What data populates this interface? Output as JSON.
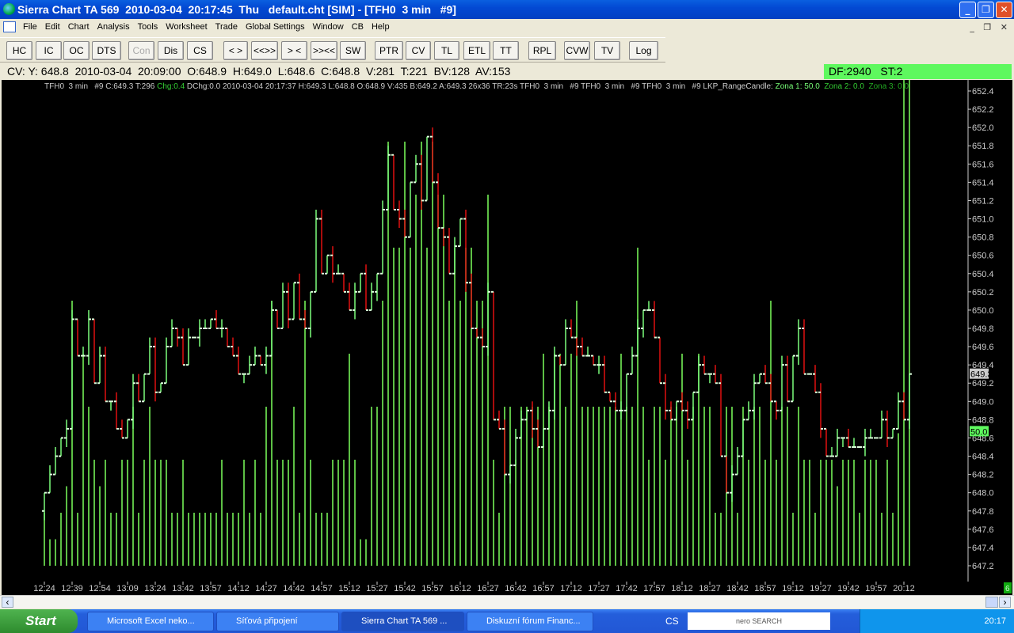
{
  "window": {
    "title": "Sierra Chart TA 569  2010-03-04  20:17:45  Thu   default.cht [SIM] - [TFH0  3 min   #9]",
    "minimize": "_",
    "restore": "❐",
    "close": "✕"
  },
  "menu": [
    "File",
    "Edit",
    "Chart",
    "Analysis",
    "Tools",
    "Worksheet",
    "Trade",
    "Global Settings",
    "Window",
    "CB",
    "Help"
  ],
  "mdi_controls": "_ ❐ ✕",
  "toolbar": [
    "HC",
    "IC",
    "OC",
    "DTS",
    "Con",
    "Dis",
    "CS",
    "< >",
    "<<>>",
    "> <",
    ">><<",
    "SW",
    "PTR",
    "CV",
    "TL",
    "ETL",
    "TT",
    "RPL",
    "CVW",
    "TV",
    "Log"
  ],
  "infobar": {
    "text": "CV: Y: 648.8  2010-03-04  20:09:00  O:648.9  H:649.0  L:648.6  C:648.8  V:281  T:221  BV:128  AV:153",
    "status": "DF:2940   ST:2"
  },
  "chart_header": {
    "a": "TFH0  3 min   #9 C:649.3 T:296 ",
    "chg": "Chg:0.4",
    "b": " DChg:0.0 2010-03-04 20:17:37 H:649.3 L:648.8 O:648.9 V:435 B:649.2 A:649.3 26x36 TR:23s TFH0  3 min   #9 TFH0  3 min   #9 TFH0  3 min   #9 LKP_RangeCandle: ",
    "z1": "Zona 1: 50.0",
    "z2": "Zona 2: 0.0",
    "z3": "Zona 3: 0.0"
  },
  "colors": {
    "up": "#7cff7c",
    "down": "#e01010",
    "volume": "#7cff5c",
    "axis": "#cccccc"
  },
  "chart_data": {
    "type": "bar",
    "ylim": [
      647.2,
      652.4
    ],
    "yticks": [
      "647.2",
      "647.4",
      "647.6",
      "647.8",
      "648.0",
      "648.2",
      "648.4",
      "648.6",
      "648.8",
      "649.0",
      "649.2",
      "649.4",
      "649.6",
      "649.8",
      "650.0",
      "650.2",
      "650.4",
      "650.6",
      "650.8",
      "651.0",
      "651.2",
      "651.4",
      "651.6",
      "651.8",
      "652.0",
      "652.2",
      "652.4"
    ],
    "xticks": [
      "12:24",
      "12:39",
      "12:54",
      "13:09",
      "13:24",
      "13:42",
      "13:57",
      "14:12",
      "14:27",
      "14:42",
      "14:57",
      "15:12",
      "15:27",
      "15:42",
      "15:57",
      "16:12",
      "16:27",
      "16:42",
      "16:57",
      "17:12",
      "17:27",
      "17:42",
      "17:57",
      "18:12",
      "18:27",
      "18:42",
      "18:57",
      "19:12",
      "19:27",
      "19:42",
      "19:57",
      "20:12"
    ],
    "first_open": 647.8,
    "close": [
      648.0,
      648.2,
      648.4,
      648.6,
      648.7,
      649.9,
      649.5,
      649.5,
      649.9,
      649.2,
      649.5,
      649.0,
      649.0,
      648.7,
      648.6,
      648.8,
      649.2,
      649.0,
      649.3,
      649.6,
      649.1,
      649.2,
      649.6,
      649.8,
      649.7,
      649.4,
      649.7,
      649.7,
      649.8,
      649.8,
      649.9,
      649.8,
      649.8,
      649.6,
      649.5,
      649.3,
      649.3,
      649.4,
      649.5,
      649.4,
      649.5,
      650.0,
      649.8,
      650.2,
      649.9,
      650.3,
      649.9,
      649.8,
      650.2,
      651.0,
      650.4,
      650.6,
      650.4,
      650.4,
      650.2,
      650.0,
      650.2,
      650.4,
      650.0,
      650.2,
      650.4,
      651.1,
      651.7,
      651.1,
      651.0,
      650.8,
      651.4,
      651.6,
      651.2,
      651.9,
      651.4,
      650.9,
      650.8,
      650.4,
      650.7,
      651.0,
      650.3,
      649.8,
      649.7,
      649.6,
      650.2,
      648.8,
      648.7,
      648.2,
      648.3,
      648.6,
      648.8,
      648.9,
      648.7,
      648.5,
      648.7,
      648.9,
      649.5,
      649.4,
      649.8,
      649.7,
      649.6,
      649.5,
      649.5,
      649.4,
      649.4,
      649.1,
      649.0,
      648.9,
      648.9,
      649.3,
      649.5,
      649.8,
      650.0,
      650.0,
      649.7,
      649.2,
      648.9,
      648.8,
      649.0,
      648.9,
      648.8,
      649.1,
      649.4,
      649.3,
      649.3,
      649.2,
      648.4,
      648.0,
      648.2,
      648.4,
      648.8,
      648.9,
      649.2,
      649.3,
      649.2,
      649.0,
      648.9,
      649.4,
      649.0,
      649.5,
      649.8,
      649.3,
      649.3,
      649.1,
      648.7,
      648.4,
      648.4,
      648.6,
      648.6,
      648.5,
      648.5,
      648.5,
      648.6,
      648.6,
      648.6,
      648.8,
      648.6,
      648.7,
      649.0,
      648.8,
      649.3
    ],
    "volume": [
      1,
      0.5,
      0.5,
      1,
      1.5,
      5,
      1,
      4,
      3,
      2,
      1.5,
      2,
      1,
      1,
      2,
      2,
      3,
      1,
      2,
      3,
      2,
      2,
      2,
      1,
      1,
      2,
      1,
      1,
      1,
      1,
      1,
      1,
      2,
      1,
      1,
      1,
      2,
      1,
      2,
      1,
      3,
      5,
      2,
      2,
      2,
      3,
      1,
      5,
      2,
      1,
      1,
      1,
      2,
      2,
      2,
      4,
      2,
      0.5,
      0.5,
      3,
      3,
      5,
      8,
      6,
      6,
      8,
      6,
      7,
      8,
      6,
      8,
      7,
      7,
      5,
      6,
      5,
      6,
      6,
      5,
      5,
      7,
      2,
      1,
      3,
      3,
      2,
      3,
      3,
      3,
      3,
      4,
      3,
      4,
      4,
      3,
      4,
      5,
      3,
      3,
      3,
      3,
      3,
      3,
      3,
      4,
      3,
      3,
      6,
      3,
      2,
      3,
      3,
      2,
      3,
      3,
      4,
      2,
      3,
      4,
      3,
      3,
      1,
      1,
      3,
      3,
      1,
      3,
      2,
      3,
      3,
      2,
      5,
      2,
      3,
      3,
      1,
      3,
      2,
      2,
      1,
      2,
      2,
      2,
      1.5,
      2,
      2,
      2,
      1,
      2,
      2,
      2,
      1,
      2,
      1,
      2.5
    ],
    "markers": {
      "last_price": "649.3",
      "zona": "50.0"
    },
    "volume_scale_label": "6"
  },
  "scrollbar": {
    "left": "‹",
    "right": "›"
  },
  "taskbar": {
    "start": "Start",
    "tasks": [
      "Microsoft Excel neko...",
      "Síťová připojení",
      "Sierra Chart TA 569  ...",
      "Diskuzní fórum Financ..."
    ],
    "lang": "CS",
    "search": "nero SEARCH",
    "clock": "20:17"
  }
}
